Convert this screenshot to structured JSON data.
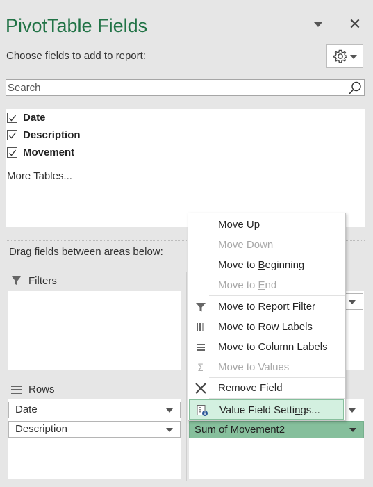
{
  "panel": {
    "title": "PivotTable Fields",
    "subtitle": "Choose fields to add to report:",
    "close_glyph": "✕"
  },
  "search": {
    "placeholder": "Search"
  },
  "fields": [
    {
      "label": "Date",
      "checked": true
    },
    {
      "label": "Description",
      "checked": true
    },
    {
      "label": "Movement",
      "checked": true
    }
  ],
  "more_tables": "More Tables...",
  "drag_label": "Drag fields between areas below:",
  "areas": {
    "filters": {
      "label": "Filters",
      "icon": "filter-icon"
    },
    "rows": {
      "label": "Rows",
      "icon": "rows-icon",
      "items": [
        "Date",
        "Description"
      ]
    },
    "values": {
      "items": [
        "Sum of Movement2"
      ]
    }
  },
  "context_menu": {
    "items": [
      {
        "pre": "Move ",
        "acc": "U",
        "post": "p",
        "enabled": true,
        "icon": ""
      },
      {
        "pre": "Move ",
        "acc": "D",
        "post": "own",
        "enabled": false,
        "icon": ""
      },
      {
        "pre": "Move to ",
        "acc": "B",
        "post": "eginning",
        "enabled": true,
        "icon": ""
      },
      {
        "pre": "Move to ",
        "acc": "E",
        "post": "nd",
        "enabled": false,
        "icon": ""
      },
      {
        "pre": "Move to Report Filter",
        "acc": "",
        "post": "",
        "enabled": true,
        "icon": "filter-icon"
      },
      {
        "pre": "Move to Row Labels",
        "acc": "",
        "post": "",
        "enabled": true,
        "icon": "row-labels-icon"
      },
      {
        "pre": "Move to Column Labels",
        "acc": "",
        "post": "",
        "enabled": true,
        "icon": "column-labels-icon"
      },
      {
        "pre": "Move to Values",
        "acc": "",
        "post": "",
        "enabled": false,
        "icon": "sigma-icon"
      },
      {
        "pre": "Remove Field",
        "acc": "",
        "post": "",
        "enabled": true,
        "icon": "remove-icon"
      },
      {
        "pre": "Value Field Setti",
        "acc": "n",
        "post": "gs...",
        "enabled": true,
        "icon": "field-settings-icon"
      }
    ]
  },
  "colors": {
    "accent": "#217346",
    "panel_bg": "#e6e6e6",
    "selected_value_chip": "#86bf9c",
    "menu_highlight": "#d3f0e0",
    "disabled_text": "#a8a8a8"
  }
}
